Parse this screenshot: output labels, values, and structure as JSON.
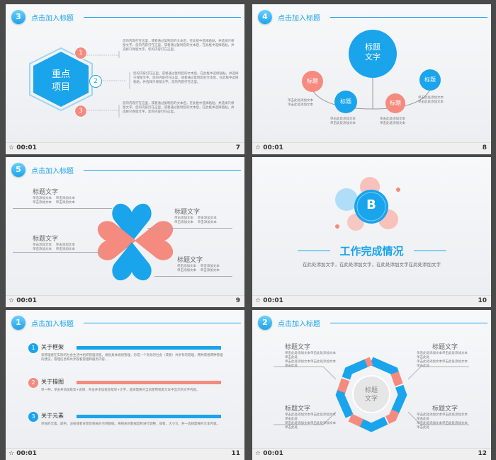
{
  "common": {
    "time": "00:01",
    "header_title": "点击加入标题"
  },
  "s7": {
    "num": "7",
    "badge": "3",
    "center": [
      "重点",
      "项目"
    ],
    "markers": [
      "1",
      "2",
      "3"
    ],
    "blocks": [
      "您的内容打在这里，或者通过复制您的文本后，在此框中选择粘贴，并选择只保留文字。您的内容打在这里，或者通过复制您的文本后，在此框中选择粘贴，并选择只保留文字。您的内容打在这里。",
      "您的内容打在这里，或者通过复制您的文本后，在此框中选择粘贴，并选择只保留文字。您的内容打在这里，或者通过复制您的文本后，在此框中选择粘贴，并选择只保留文字。您的内容打在这里。",
      "您的内容打在这里，或者通过复制您的文本后，在此框中选择粘贴，并选择只保留文字。您的内容打在这里，或者通过复制您的文本后，在此框中选择粘贴，并选择只保留文字。您的内容打在这里。"
    ]
  },
  "s8": {
    "num": "8",
    "badge": "4",
    "big": [
      "标题",
      "文字"
    ],
    "bubbles": [
      "标题",
      "标题",
      "标题",
      "标题"
    ],
    "notes": [
      "单击此处添加文本",
      "单击此处添加文本"
    ]
  },
  "s9": {
    "num": "9",
    "badge": "5",
    "label": "标题文字",
    "note": "单击添加文本",
    "blocks": [
      "标题文字",
      "标题文字",
      "标题文字",
      "标题文字"
    ]
  },
  "s10": {
    "num": "10",
    "badge_letter": "B",
    "title": "工作完成情况",
    "subtitle": "在此处添加文字，在此处添加文字，在此处添加文字在此处添加文字"
  },
  "s11": {
    "num": "11",
    "badge": "1",
    "items": [
      {
        "marker": "1",
        "title": "关于框架",
        "text": "采管理者在实际的社会生活中组织管理流程，规划具体规划管理，形成一个有效的社会（或者）共享有的管理，两种或者两种管理的建议，管理信息和共享观看管理和服务内容。"
      },
      {
        "marker": "2",
        "title": "关于操图",
        "text": "单一种，单击并添加框架+说明，单击并添加框架框架+文字，选择需要对当前使用或者文本中显示的文字内容。"
      },
      {
        "marker": "3",
        "title": "关于元素",
        "text": "单独的元素、颜色、渲染或者背景等相关的点阵数据，将相关的数据结构进行调整，或者，大小写，并一选择需要的文本内容。"
      }
    ]
  },
  "s12": {
    "num": "12",
    "badge": "2",
    "center": [
      "标题",
      "文字"
    ],
    "label": "标题文字",
    "note": "单击此处添加文本单击此处添加文本单击此处"
  },
  "colors": {
    "blue": "#1aa4ec",
    "pink": "#f58a7f",
    "light": "#f2f3f5"
  }
}
